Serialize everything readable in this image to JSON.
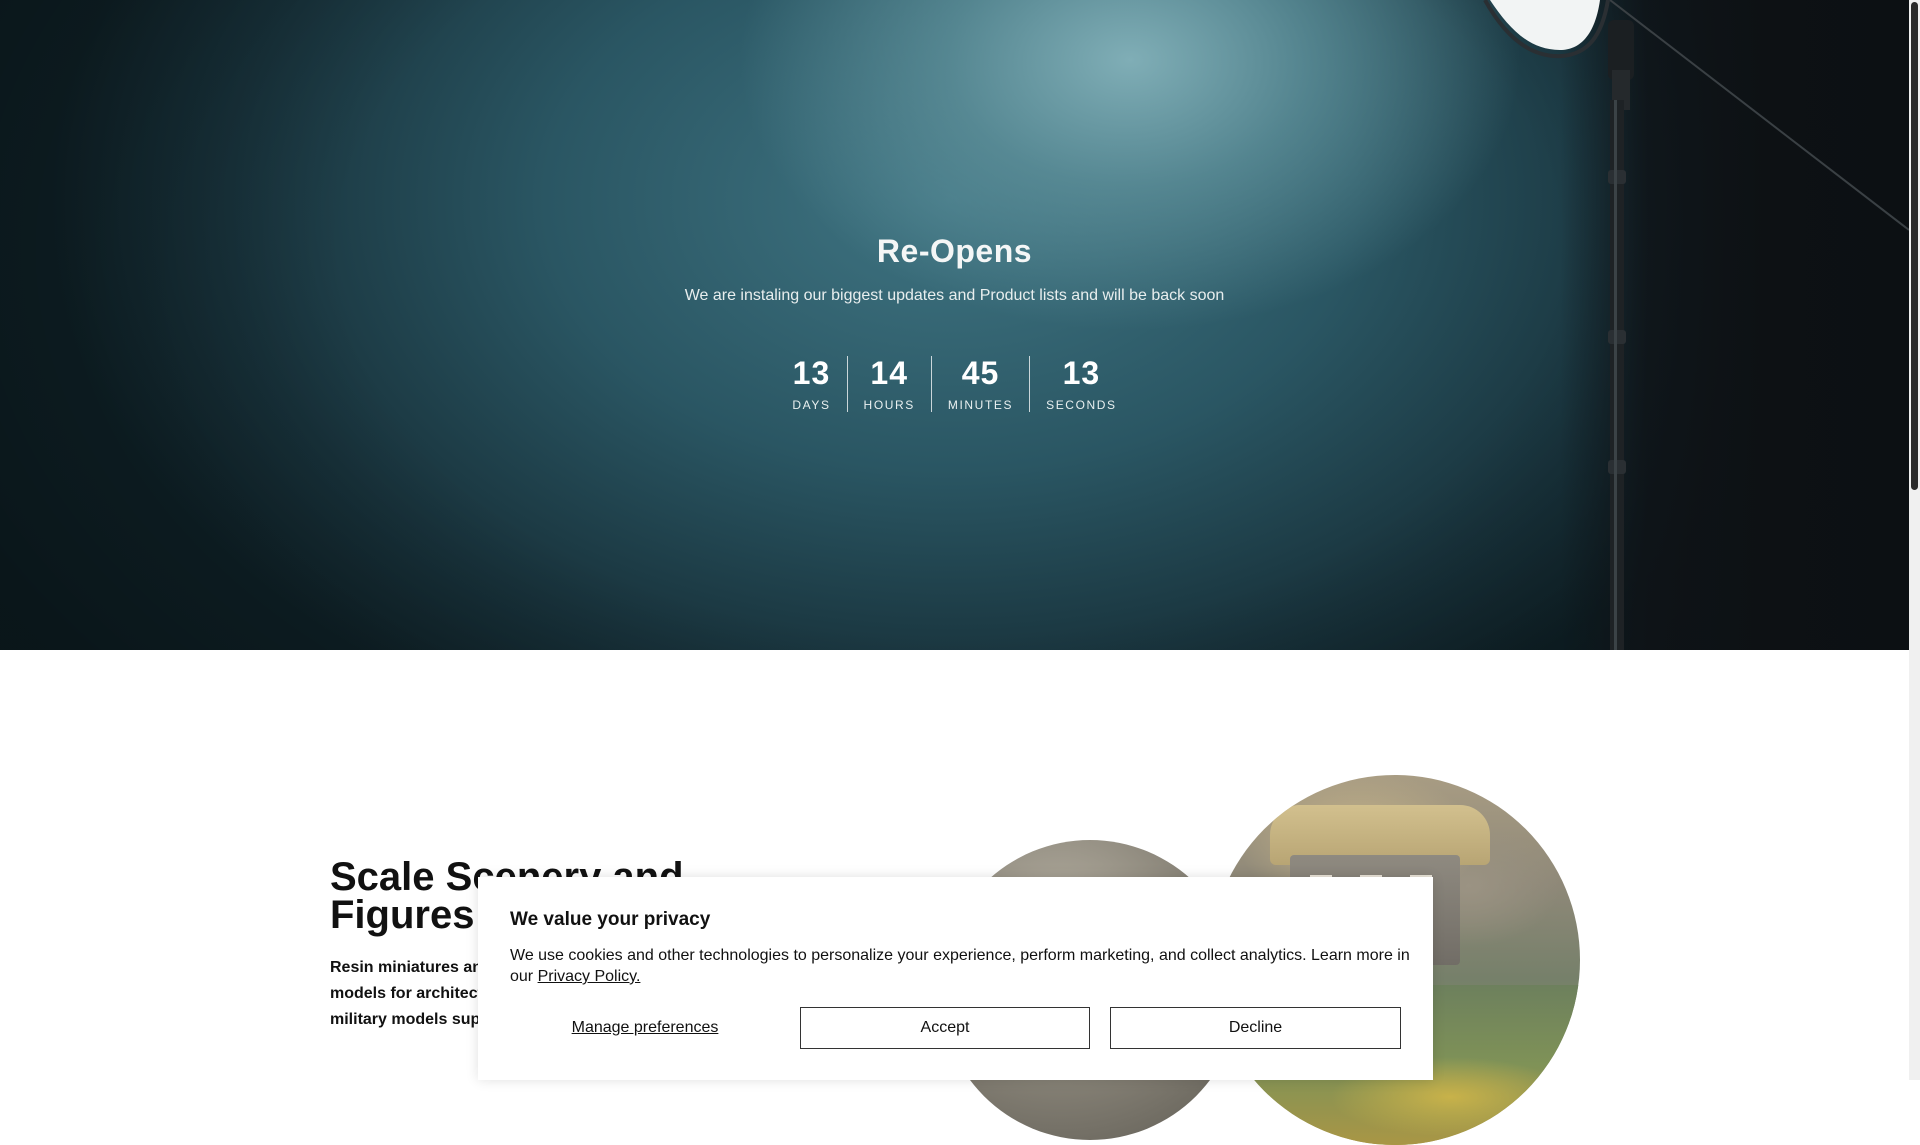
{
  "hero": {
    "title": "Re-Opens",
    "subtitle": "We are instaling our biggest updates and Product lists and will be back soon",
    "countdown": [
      {
        "value": "13",
        "label": "DAYS"
      },
      {
        "value": "14",
        "label": "HOURS"
      },
      {
        "value": "45",
        "label": "MINUTES"
      },
      {
        "value": "13",
        "label": "SECONDS"
      }
    ]
  },
  "section": {
    "title": "Scale Scenery and Figures",
    "body": "Resin miniatures and figures to create realistic models for architectural layouts, dioramas and military models supplies"
  },
  "cookie": {
    "title": "We value your privacy",
    "text": "We use cookies and other technologies to personalize your experience, perform marketing, and collect analytics. Learn more in our",
    "link": "Privacy Policy.",
    "manage": "Manage preferences",
    "accept": "Accept",
    "decline": "Decline"
  }
}
